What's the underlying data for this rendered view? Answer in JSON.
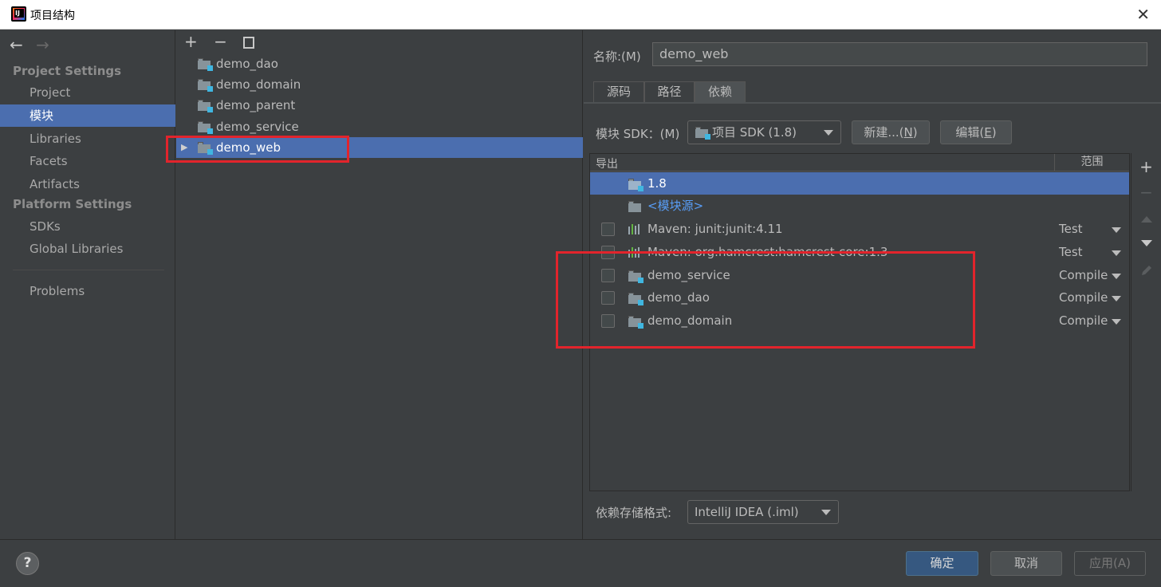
{
  "window": {
    "title": "项目结构",
    "close_glyph": "✕"
  },
  "nav": {
    "back": "←",
    "forward": "→",
    "project_settings": "Project Settings",
    "platform_settings": "Platform Settings",
    "items": [
      {
        "label": "Project"
      },
      {
        "label": "模块"
      },
      {
        "label": "Libraries"
      },
      {
        "label": "Facets"
      },
      {
        "label": "Artifacts"
      },
      {
        "label": "SDKs"
      },
      {
        "label": "Global Libraries"
      },
      {
        "label": "Problems"
      }
    ]
  },
  "tree": {
    "toolbar": {
      "add": "+",
      "remove": "−"
    },
    "modules": [
      {
        "label": "demo_dao"
      },
      {
        "label": "demo_domain"
      },
      {
        "label": "demo_parent"
      },
      {
        "label": "demo_service"
      },
      {
        "label": "demo_web",
        "expand_glyph": "▶"
      }
    ]
  },
  "detail": {
    "name_label": "名称:(M)",
    "name_value": "demo_web",
    "tabs": [
      {
        "label": "源码"
      },
      {
        "label": "路径"
      },
      {
        "label": "依赖"
      }
    ],
    "sdk_label": "模块 SDK：(M)",
    "sdk_value": "项目 SDK (1.8)",
    "new_button": {
      "text": "新建...(",
      "mnemonic": "N",
      "close": ")"
    },
    "edit_button": {
      "text": "编辑(",
      "mnemonic": "E",
      "close": ")"
    },
    "table": {
      "col_export": "导出",
      "col_scope": "范围",
      "rows": [
        {
          "name": "1.8"
        },
        {
          "name": "<模块源>"
        },
        {
          "name": "Maven: junit:junit:4.11",
          "scope": "Test"
        },
        {
          "name": "Maven: org.hamcrest:hamcrest-core:1.3",
          "scope": "Test"
        },
        {
          "name": "demo_service",
          "scope": "Compile"
        },
        {
          "name": "demo_dao",
          "scope": "Compile"
        },
        {
          "name": "demo_domain",
          "scope": "Compile"
        }
      ]
    },
    "tools": {
      "add": "+",
      "remove": "−"
    },
    "storage_label": "依赖存储格式:",
    "storage_value": "IntelliJ IDEA (.iml)"
  },
  "footer": {
    "help": "?",
    "ok": "确定",
    "cancel": "取消",
    "apply": "应用(A)"
  },
  "colors": {
    "selection": "#4b6eaf",
    "highlight": "#e2242c",
    "link": "#589df6"
  }
}
